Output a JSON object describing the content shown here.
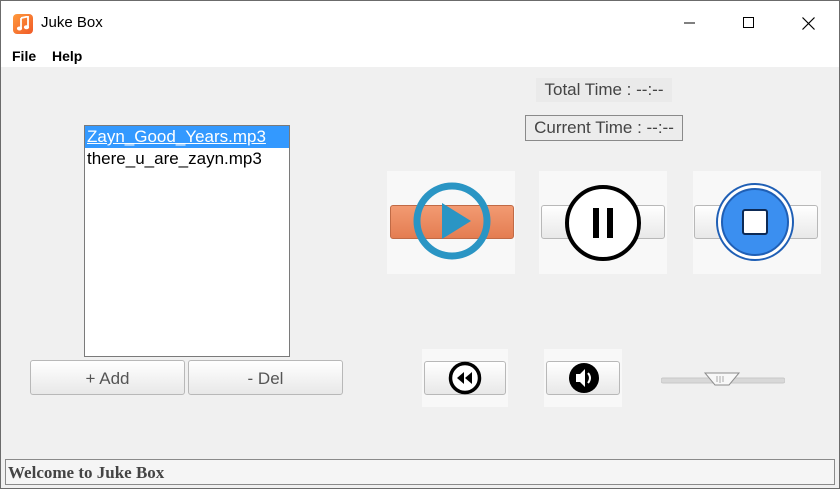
{
  "window": {
    "title": "Juke Box"
  },
  "menu": {
    "file": "File",
    "help": "Help"
  },
  "times": {
    "total": "Total Time : --:--",
    "current": "Current Time : --:--"
  },
  "playlist": {
    "tracks": [
      {
        "name": "Zayn_Good_Years.mp3",
        "selected": true
      },
      {
        "name": "there_u_are_zayn.mp3",
        "selected": false
      }
    ]
  },
  "buttons": {
    "add": "+ Add",
    "del": "- Del"
  },
  "controls": {
    "play_icon": "play-circle-icon",
    "pause_icon": "pause-circle-icon",
    "stop_icon": "stop-circle-icon",
    "rewind_icon": "rewind-icon",
    "volume_icon": "speaker-icon",
    "play_bar_color": "#ec8a5e",
    "play_ring_color": "#2a95c4",
    "stop_fill_color": "#3b8ff0"
  },
  "status": {
    "message": "Welcome to Juke Box"
  }
}
